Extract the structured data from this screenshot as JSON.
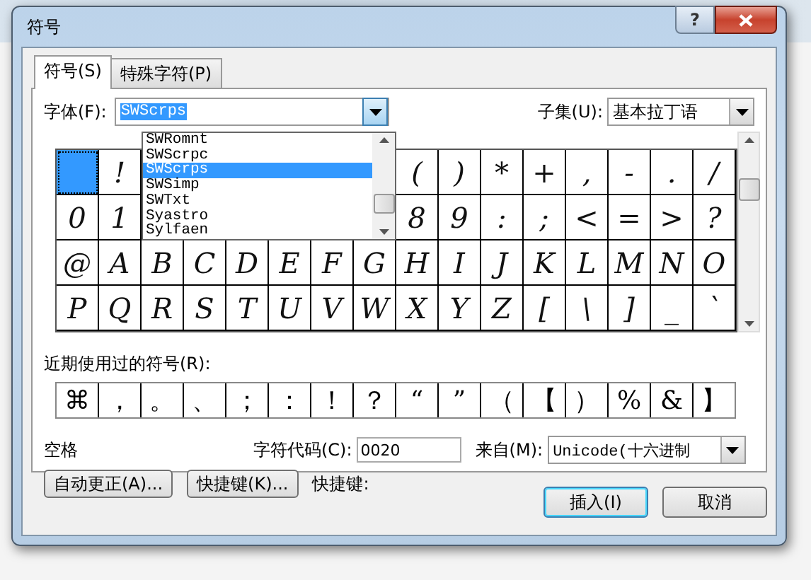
{
  "window": {
    "title": "符号",
    "help": "?"
  },
  "tabs": [
    {
      "label": "符号(S)",
      "selected": true
    },
    {
      "label": "特殊字符(P)",
      "selected": false
    }
  ],
  "font": {
    "label": "字体(F):",
    "value": "SWScrps",
    "expanded": true,
    "options": [
      {
        "label": "SWRomnt",
        "selected": false
      },
      {
        "label": "SWScrpc",
        "selected": false
      },
      {
        "label": "SWScrps",
        "selected": true
      },
      {
        "label": "SWSimp",
        "selected": false
      },
      {
        "label": "SWTxt",
        "selected": false
      },
      {
        "label": "Syastro",
        "selected": false
      },
      {
        "label": "Sylfaen",
        "selected": false
      }
    ]
  },
  "subset": {
    "label": "子集(U):",
    "value": "基本拉丁语"
  },
  "grid": [
    {
      "selected": true
    },
    {
      "char": "!",
      "selected": false
    },
    {
      "char": "(",
      "selected": false
    },
    {
      "char": ")",
      "selected": false
    },
    {
      "char": "*",
      "selected": false
    },
    {
      "char": "+",
      "selected": false
    },
    {
      "char": ",",
      "selected": false
    },
    {
      "char": "-",
      "selected": false
    },
    {
      "char": ".",
      "selected": false
    },
    {
      "char": "/",
      "selected": false
    },
    {
      "char": "0",
      "selected": false
    },
    {
      "char": "1",
      "selected": false
    },
    {
      "char": "8",
      "selected": false
    },
    {
      "char": "9",
      "selected": false
    },
    {
      "char": ":",
      "selected": false
    },
    {
      "char": ";",
      "selected": false
    },
    {
      "char": "<",
      "selected": false
    },
    {
      "char": "=",
      "selected": false
    },
    {
      "char": ">",
      "selected": false
    },
    {
      "char": "?",
      "selected": false
    },
    {
      "char": "@",
      "selected": false
    },
    {
      "char": "A",
      "selected": false
    },
    {
      "char": "B",
      "selected": false
    },
    {
      "char": "C",
      "selected": false
    },
    {
      "char": "D",
      "selected": false
    },
    {
      "char": "E",
      "selected": false
    },
    {
      "char": "F",
      "selected": false
    },
    {
      "char": "G",
      "selected": false
    },
    {
      "char": "H",
      "selected": false
    },
    {
      "char": "I",
      "selected": false
    },
    {
      "char": "J",
      "selected": false
    },
    {
      "char": "K",
      "selected": false
    },
    {
      "char": "L",
      "selected": false
    },
    {
      "char": "M",
      "selected": false
    },
    {
      "char": "N",
      "selected": false
    },
    {
      "char": "O",
      "selected": false
    },
    {
      "char": "P",
      "selected": false
    },
    {
      "char": "Q",
      "selected": false
    },
    {
      "char": "R",
      "selected": false
    },
    {
      "char": "S",
      "selected": false
    },
    {
      "char": "T",
      "selected": false
    },
    {
      "char": "U",
      "selected": false
    },
    {
      "char": "V",
      "selected": false
    },
    {
      "char": "W",
      "selected": false
    },
    {
      "char": "X",
      "selected": false
    },
    {
      "char": "Y",
      "selected": false
    },
    {
      "char": "Z",
      "selected": false
    },
    {
      "char": "[",
      "selected": false
    },
    {
      "char": "\\",
      "selected": false
    },
    {
      "char": "]",
      "selected": false
    },
    {
      "char": "_",
      "selected": false
    },
    {
      "char": "`",
      "selected": false
    }
  ],
  "recent": {
    "label": "近期使用过的符号(R):",
    "symbols": [
      "⌘",
      "，",
      "。",
      "、",
      "；",
      "：",
      "！",
      "？",
      "“",
      "”",
      "（",
      "【",
      "）",
      "%",
      "&",
      "】"
    ]
  },
  "char_name": "空格",
  "char_code": {
    "label": "字符代码(C):",
    "value": "0020"
  },
  "from": {
    "label": "来自(M):",
    "value": "Unicode(十六进制"
  },
  "tool_buttons": [
    "自动更正(A)...",
    "快捷键(K)..."
  ],
  "shortcut_label": "快捷键:",
  "buttons": [
    {
      "label": "插入(I)",
      "default": true
    },
    {
      "label": "取消",
      "default": false
    }
  ]
}
